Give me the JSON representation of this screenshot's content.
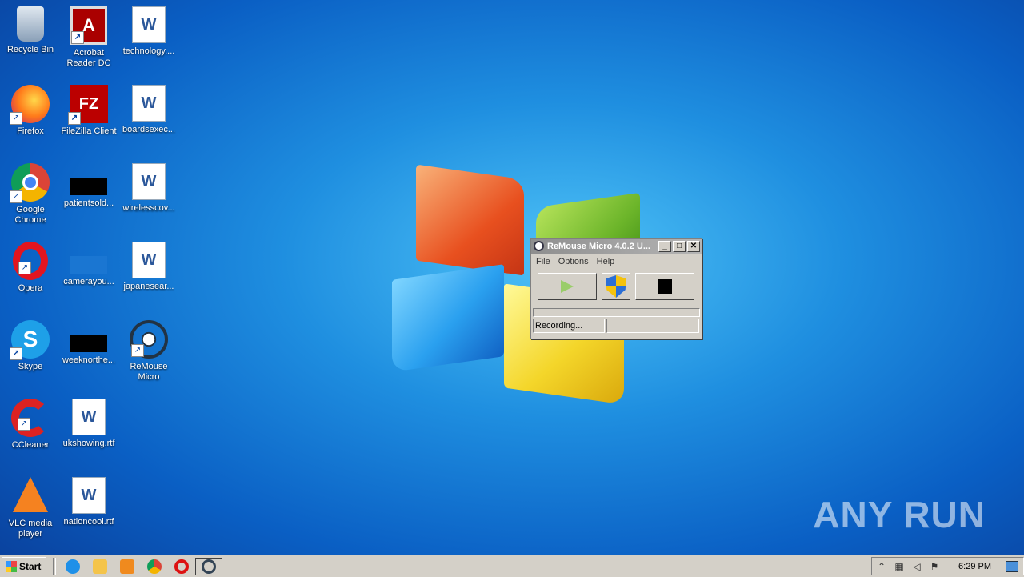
{
  "desktop": {
    "icons": [
      {
        "label": "Recycle Bin"
      },
      {
        "label": "Acrobat Reader DC"
      },
      {
        "label": "technology...."
      },
      {
        "label": "Firefox"
      },
      {
        "label": "FileZilla Client"
      },
      {
        "label": "boardsexec..."
      },
      {
        "label": "Google Chrome"
      },
      {
        "label": "patientsold..."
      },
      {
        "label": "wirelesscov..."
      },
      {
        "label": "Opera"
      },
      {
        "label": "camerayou..."
      },
      {
        "label": "japanesear..."
      },
      {
        "label": "Skype"
      },
      {
        "label": "weeknorthe..."
      },
      {
        "label": "ReMouse Micro"
      },
      {
        "label": "CCleaner"
      },
      {
        "label": "ukshowing.rtf"
      },
      {
        "label": "VLC media player"
      },
      {
        "label": "nationcool.rtf"
      }
    ]
  },
  "remouse_window": {
    "title": "ReMouse Micro 4.0.2 U...",
    "menu": [
      "File",
      "Options",
      "Help"
    ],
    "status": "Recording..."
  },
  "watermark": "ANY RUN",
  "taskbar": {
    "start_label": "Start",
    "clock": "6:29 PM"
  }
}
